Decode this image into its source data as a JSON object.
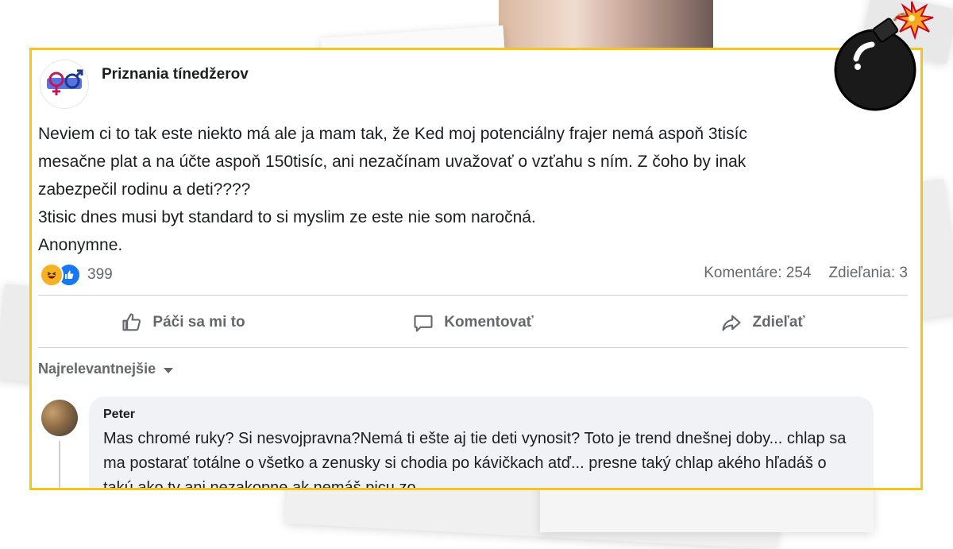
{
  "page": {
    "name": "Priznania tínedžerov"
  },
  "post": {
    "text": "Neviem ci to tak este niekto má ale ja mam tak, že Ked moj potenciálny frajer nemá aspoň 3tisíc\nmesačne plat a na účte aspoň 150tisíc, ani nezačínam uvažovať o vzťahu s ním. Z čoho by inak\nzabezpečil rodinu a deti????\n3tisic dnes musi byt standard to si myslim ze este nie som naročná.\nAnonymne."
  },
  "stats": {
    "reactions": "399",
    "comments": "Komentáre: 254",
    "shares": "Zdieľania: 3"
  },
  "actions": {
    "like": "Páči sa mi to",
    "comment": "Komentovať",
    "share": "Zdieľať"
  },
  "sort": {
    "label": "Najrelevantnejšie"
  },
  "comment": {
    "author": "Peter",
    "text": "Mas chromé ruky? Si nesvojpravna?Nemá ti ešte aj tie deti vynosit? Toto je trend dnešnej doby... chlap sa ma postarať totálne o všetko a zenusky si chodia po kávičkach atď... presne taký chlap akého hľadáš o takú ako ty ani nezakopne ak nemáš picu zo"
  },
  "icons": [
    "page-logo-icon",
    "haha-icon",
    "like-icon",
    "thumbs-up-icon",
    "comment-icon",
    "share-icon",
    "chevron-down-icon",
    "bomb-icon"
  ],
  "colors": {
    "frame": "#f5c518",
    "like_blue": "#1877f2",
    "haha_yellow": "#f7b125",
    "text": "#1c1e21",
    "muted": "#65676b"
  }
}
